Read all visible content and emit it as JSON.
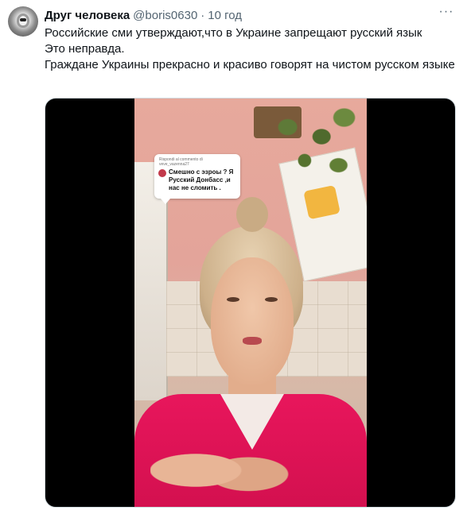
{
  "tweet": {
    "display_name": "Друг человека",
    "handle": "@boris0630",
    "separator": "·",
    "timestamp": "10 год",
    "more_icon": "more-horizontal-icon",
    "text_lines": [
      "Российские сми утверждают,что в Украине запрещают русский язык",
      "Это неправда.",
      "Граждане Украины прекрасно и красиво говорят на чистом русском языке"
    ]
  },
  "video": {
    "comment_overlay": {
      "reply_label": "Rispondi al commento di",
      "username": "veve_vazenna27",
      "comment_text": "Смешно с эзроы ? Я\nРусский Донбасс ,и\nнас не сломить ."
    }
  }
}
